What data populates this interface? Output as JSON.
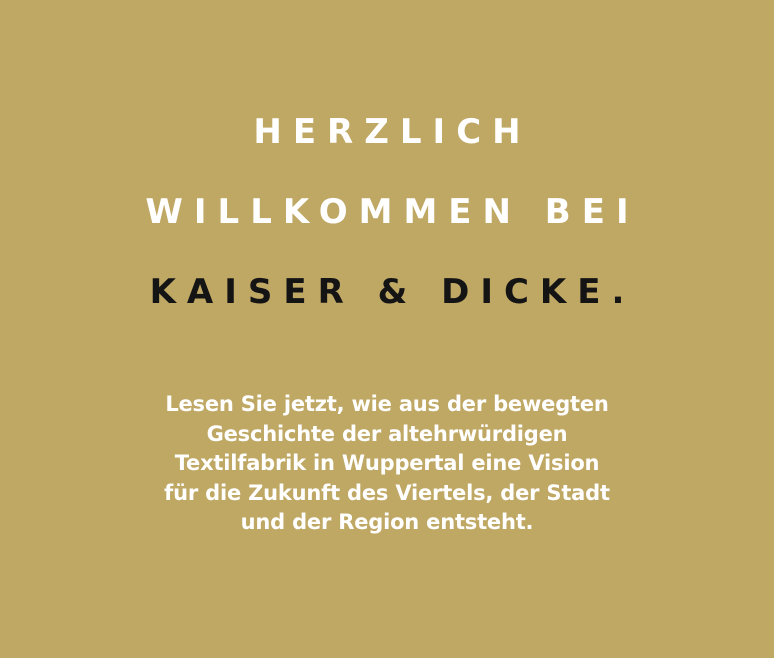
{
  "colors": {
    "background": "#bfa764",
    "headline_light": "#ffffff",
    "headline_dark": "#141414",
    "body_text": "#ffffff"
  },
  "headline": {
    "lines": [
      "HERZLICH",
      "WILLKOMMEN BEI",
      "KAISER & DICKE."
    ]
  },
  "intro": {
    "lines": [
      "Lesen Sie jetzt, wie aus der bewegten",
      "Geschichte der altehrwürdigen",
      "Textilfabrik in Wuppertal eine Vision",
      "für die Zukunft des Viertels, der Stadt",
      "und der Region entsteht."
    ]
  }
}
